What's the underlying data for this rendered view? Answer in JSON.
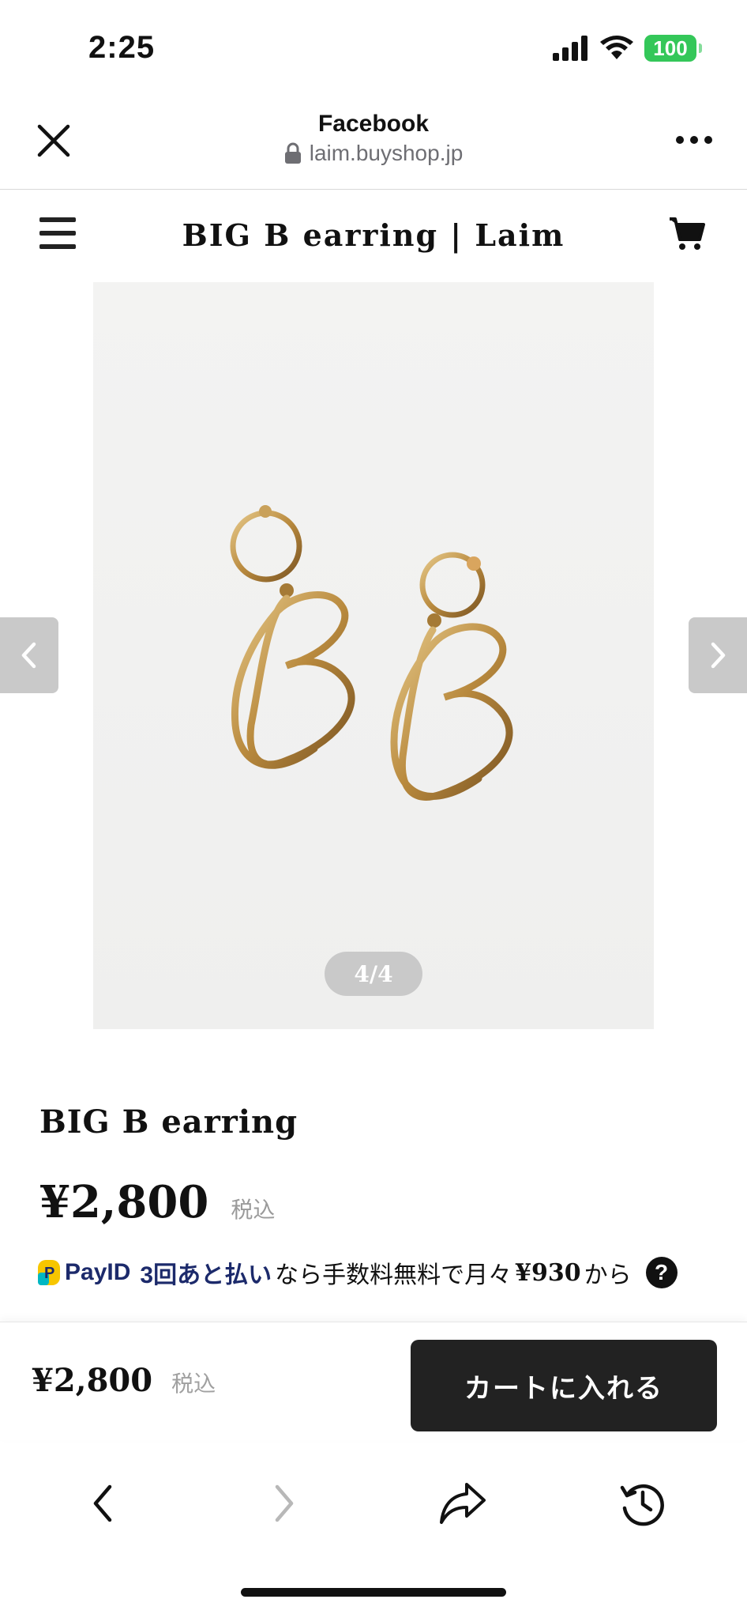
{
  "status_bar": {
    "time": "2:25",
    "battery": "100",
    "icons": [
      "signal-icon",
      "wifi-icon",
      "battery-icon"
    ]
  },
  "browser": {
    "title": "Facebook",
    "url": "laim.buyshop.jp",
    "icons": [
      "close-icon",
      "lock-icon",
      "more-icon"
    ]
  },
  "shop": {
    "title": "BIG B earring | Laim",
    "icons": [
      "hamburger-menu-icon",
      "cart-icon"
    ]
  },
  "gallery": {
    "counter": "4/4",
    "image_description_icon": "earrings-photo"
  },
  "product": {
    "name": "BIG B earring",
    "price": "¥2,800",
    "tax_label": "税込"
  },
  "payid": {
    "brand": "PayID",
    "offer": "3回あと払い",
    "text_before_amount": "なら手数料無料で月々",
    "amount": "¥930",
    "text_after_amount": "から",
    "help": "?"
  },
  "cart_bar": {
    "price": "¥2,800",
    "tax_label": "税込",
    "button_label": "カートに入れる"
  },
  "toolbar": {
    "icons": [
      "back-icon",
      "forward-icon",
      "share-icon",
      "history-icon"
    ]
  },
  "colors": {
    "battery": "#34c759",
    "payid_brand": "#1c2a6b",
    "cart_button": "#222222",
    "gold": "#c9a15a"
  }
}
